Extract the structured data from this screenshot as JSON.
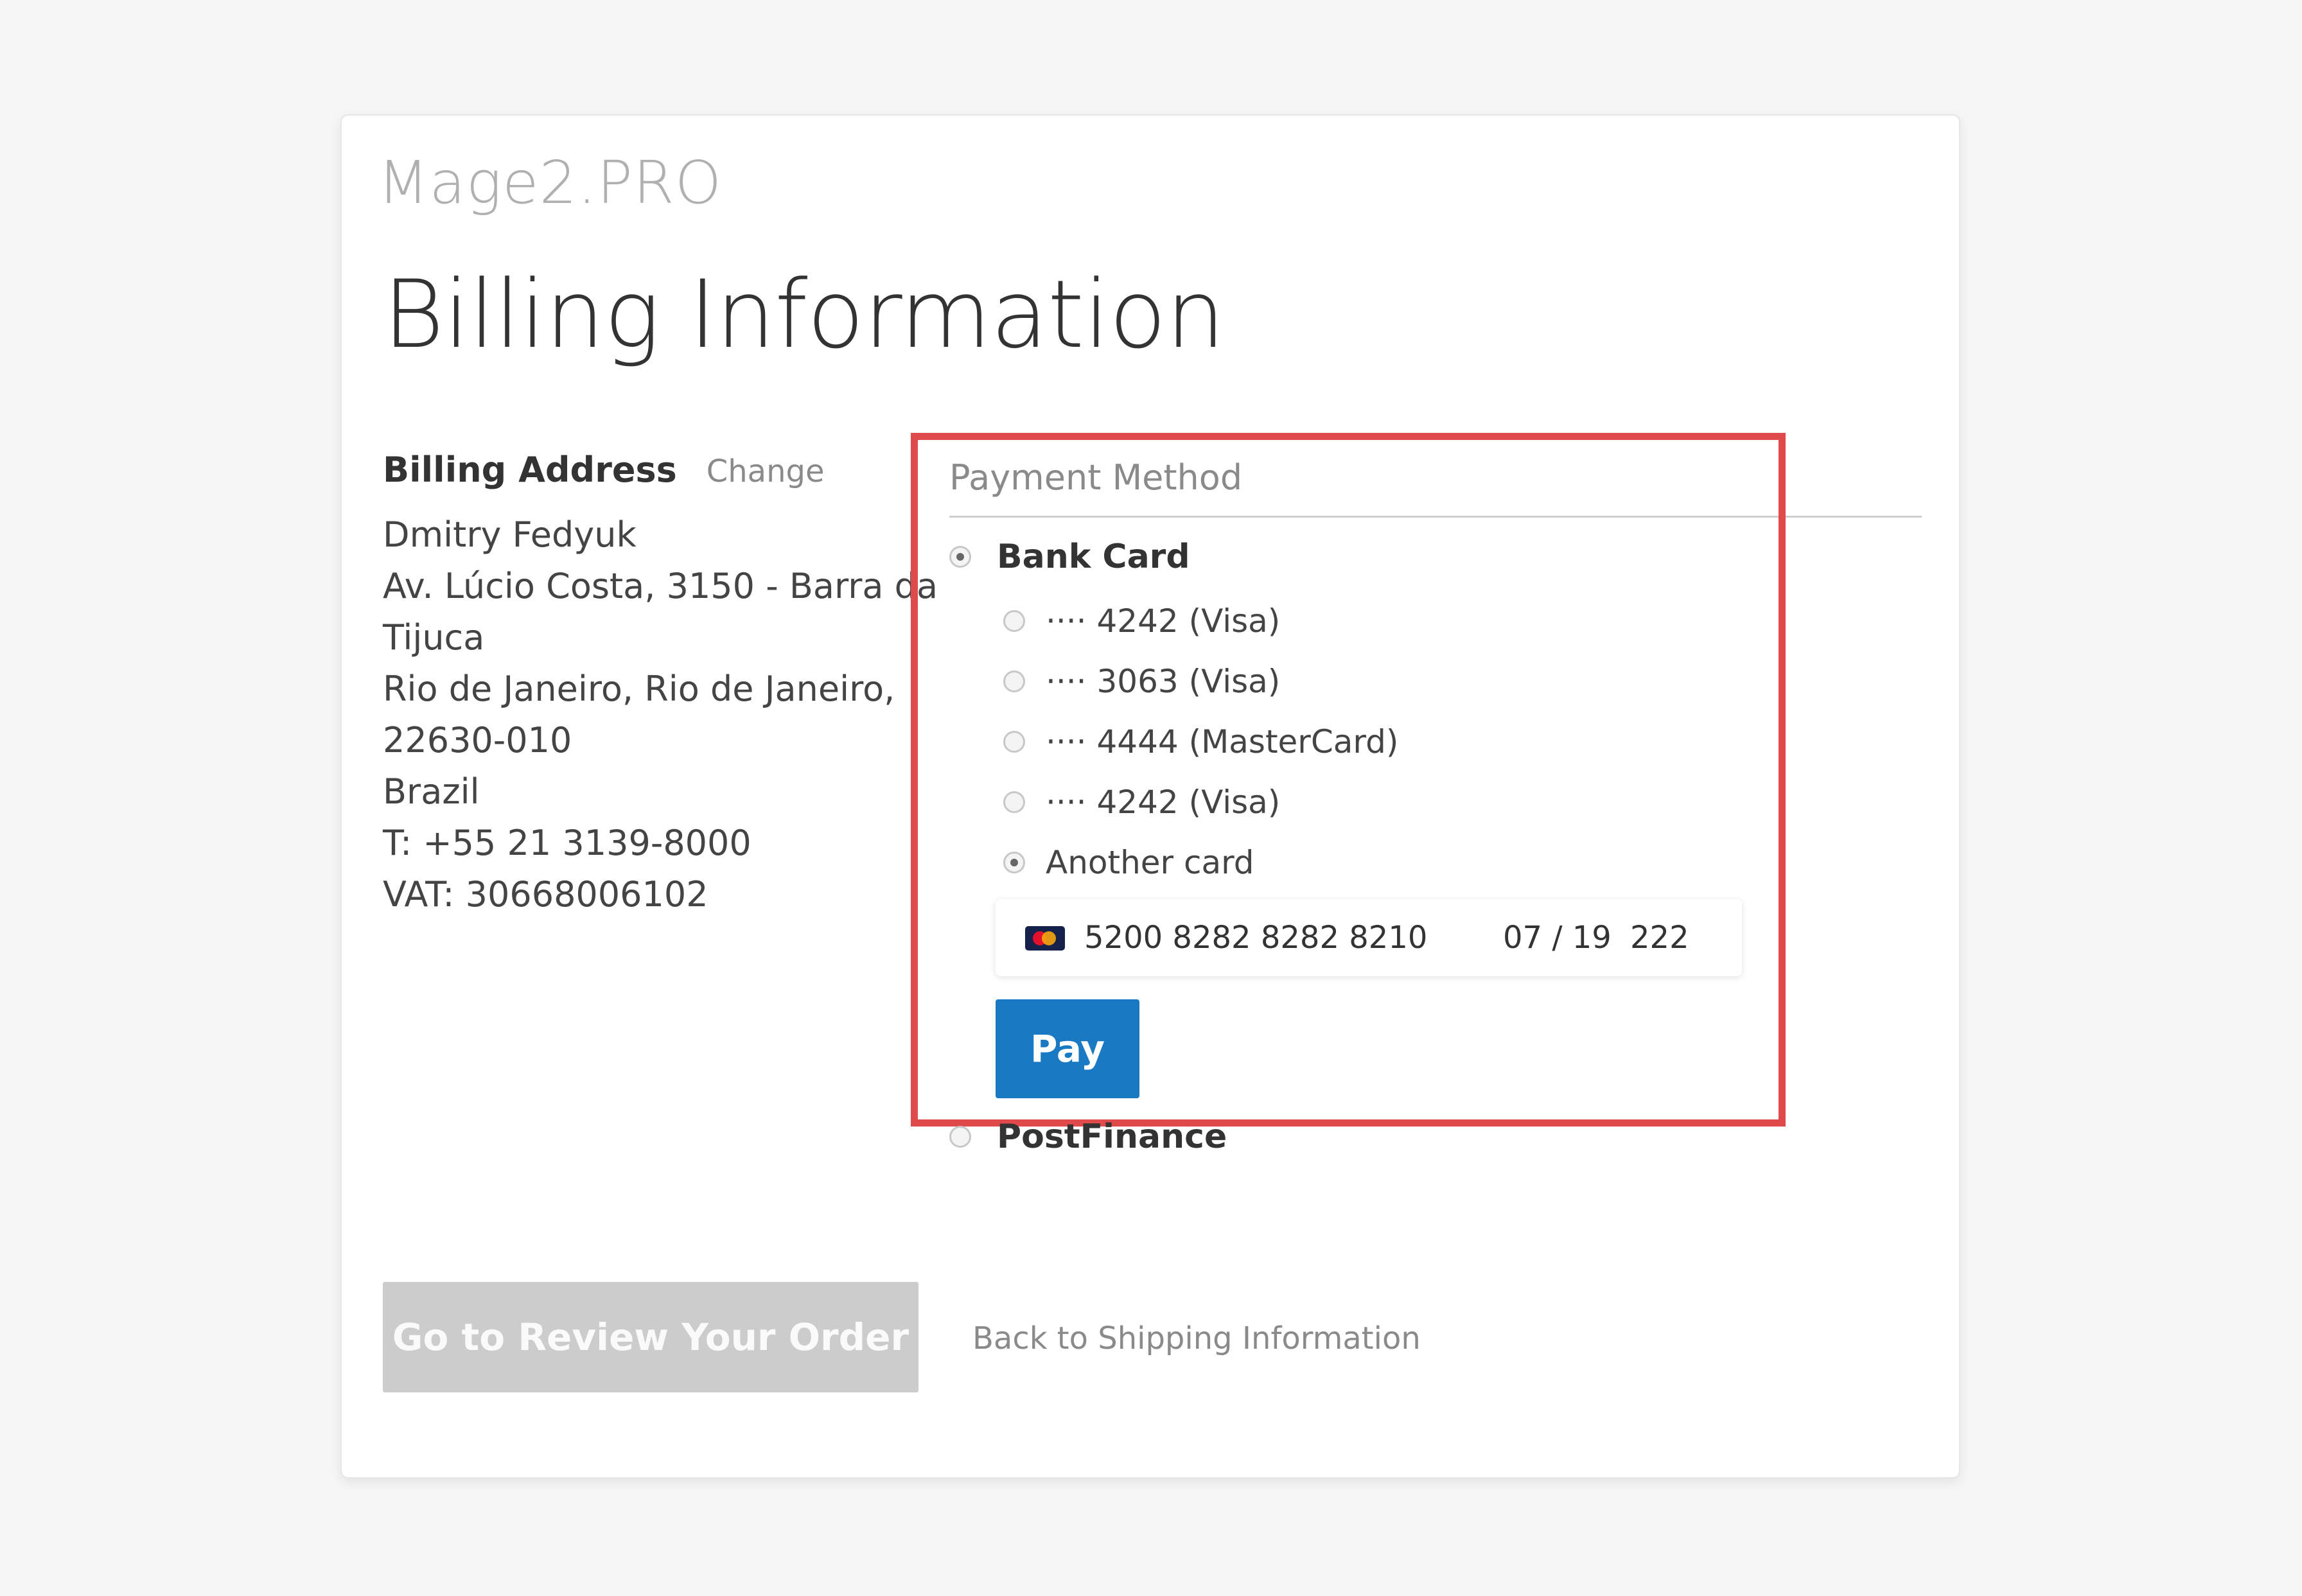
{
  "brand": {
    "logo_text": "Mage2.PRO"
  },
  "page": {
    "title": "Billing Information"
  },
  "billing_address": {
    "heading": "Billing Address",
    "change_label": "Change",
    "lines": [
      "Dmitry Fedyuk",
      "Av. Lúcio Costa, 3150 - Barra da",
      "Tijuca",
      "Rio de Janeiro, Rio de Janeiro,",
      "22630-010",
      "Brazil",
      "T: +55 21 3139-8000",
      "VAT: 30668006102"
    ]
  },
  "payment": {
    "heading": "Payment Method",
    "methods": [
      {
        "label": "Bank Card",
        "selected": true
      },
      {
        "label": "PostFinance",
        "selected": false
      }
    ],
    "saved_cards": [
      {
        "label": "···· 4242 (Visa)",
        "selected": false
      },
      {
        "label": "···· 3063 (Visa)",
        "selected": false
      },
      {
        "label": "···· 4444 (MasterCard)",
        "selected": false
      },
      {
        "label": "···· 4242 (Visa)",
        "selected": false
      },
      {
        "label": "Another card",
        "selected": true
      }
    ],
    "new_card": {
      "brand_icon": "mastercard-icon",
      "number": "5200 8282 8282 8210",
      "expiry": "07 / 19",
      "cvc": "222"
    },
    "pay_label": "Pay"
  },
  "actions": {
    "review_label": "Go to Review Your Order",
    "back_label": "Back to Shipping Information"
  },
  "colors": {
    "accent": "#1979c3",
    "highlight": "#e04a4a",
    "disabled_button": "#cccccc"
  }
}
